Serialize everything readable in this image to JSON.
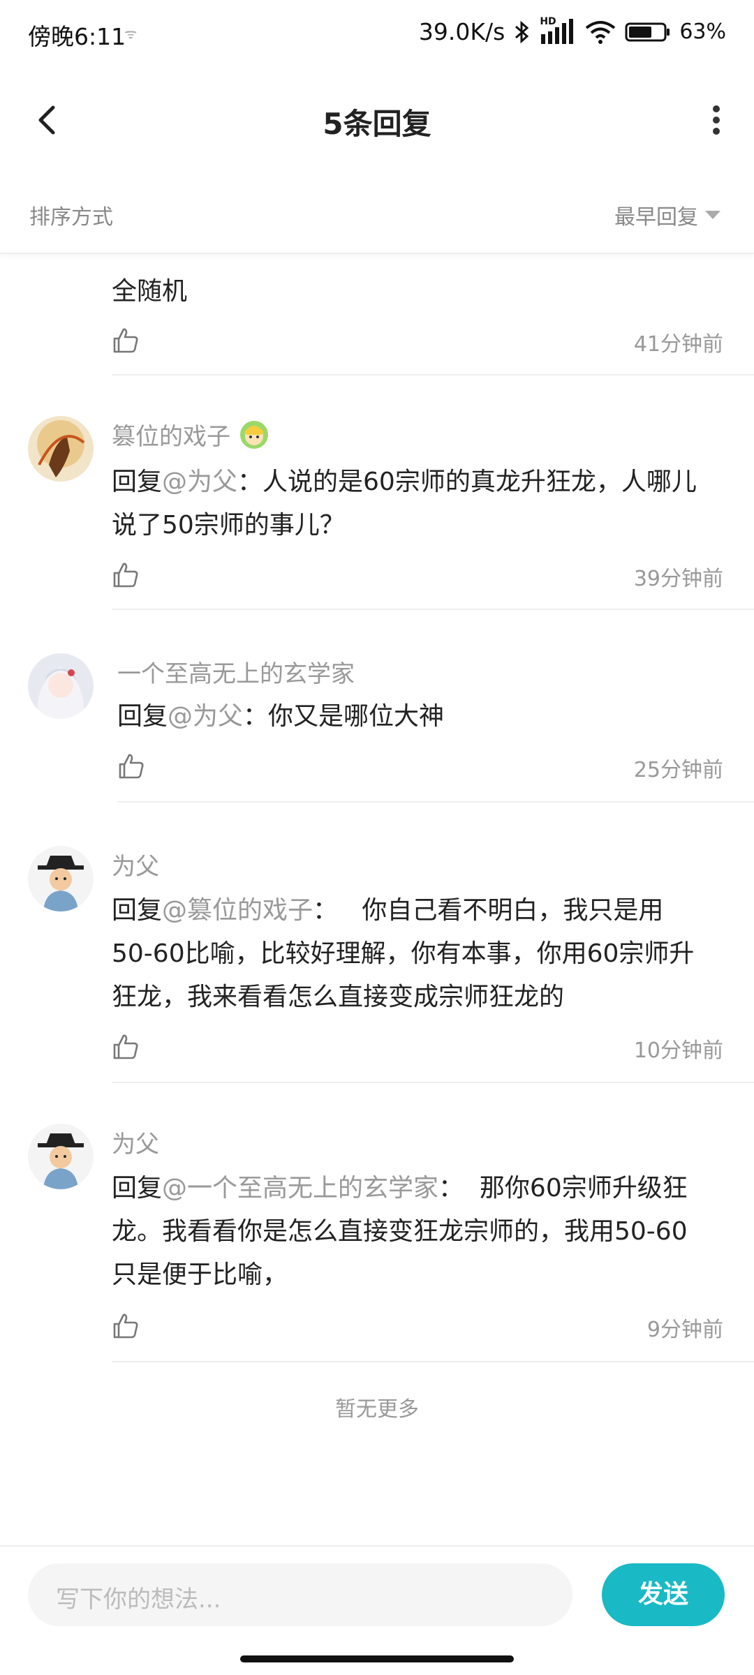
{
  "status_bar": {
    "time": "傍晚6:11",
    "small_icon": "ᯤ",
    "speed": "39.0K/s",
    "hd": "HD",
    "battery": "63%"
  },
  "header": {
    "title": "5条回复"
  },
  "sort": {
    "label": "排序方式",
    "value": "最早回复"
  },
  "partial_comment": {
    "text": "全随机",
    "time": "41分钟前"
  },
  "comments": [
    {
      "name": "篡位的戏子",
      "reply_prefix": "回复",
      "reply_to": "@为父",
      "text_line1": "：人说的是60宗师的真龙升狂龙，人哪儿",
      "text_line2": "说了50宗师的事儿？",
      "time": "39分钟前"
    },
    {
      "name": "一个至高无上的玄学家",
      "reply_prefix": "回复",
      "reply_to": "@为父",
      "text_line1": "：你又是哪位大神",
      "time": "25分钟前"
    },
    {
      "name": "为父",
      "reply_prefix": "回复",
      "reply_to": "@篡位的戏子",
      "text_line1": "：   你自己看不明白，我只是用",
      "text_line2": "50-60比喻，比较好理解，你有本事，你用60宗师升",
      "text_line3": "狂龙，我来看看怎么直接变成宗师狂龙的",
      "time": "10分钟前"
    },
    {
      "name": "为父",
      "reply_prefix": "回复",
      "reply_to": "@一个至高无上的玄学家",
      "text_line1": "：  那你60宗师升级狂",
      "text_line2": "龙。我看看你是怎么直接变狂龙宗师的，我用50-60",
      "text_line3": "只是便于比喻，",
      "time": "9分钟前"
    }
  ],
  "footer_note": "暂无更多",
  "composer": {
    "placeholder": "写下你的想法...",
    "send_label": "发送"
  },
  "colors": {
    "accent": "#19b9c5",
    "muted_text": "#999999"
  }
}
